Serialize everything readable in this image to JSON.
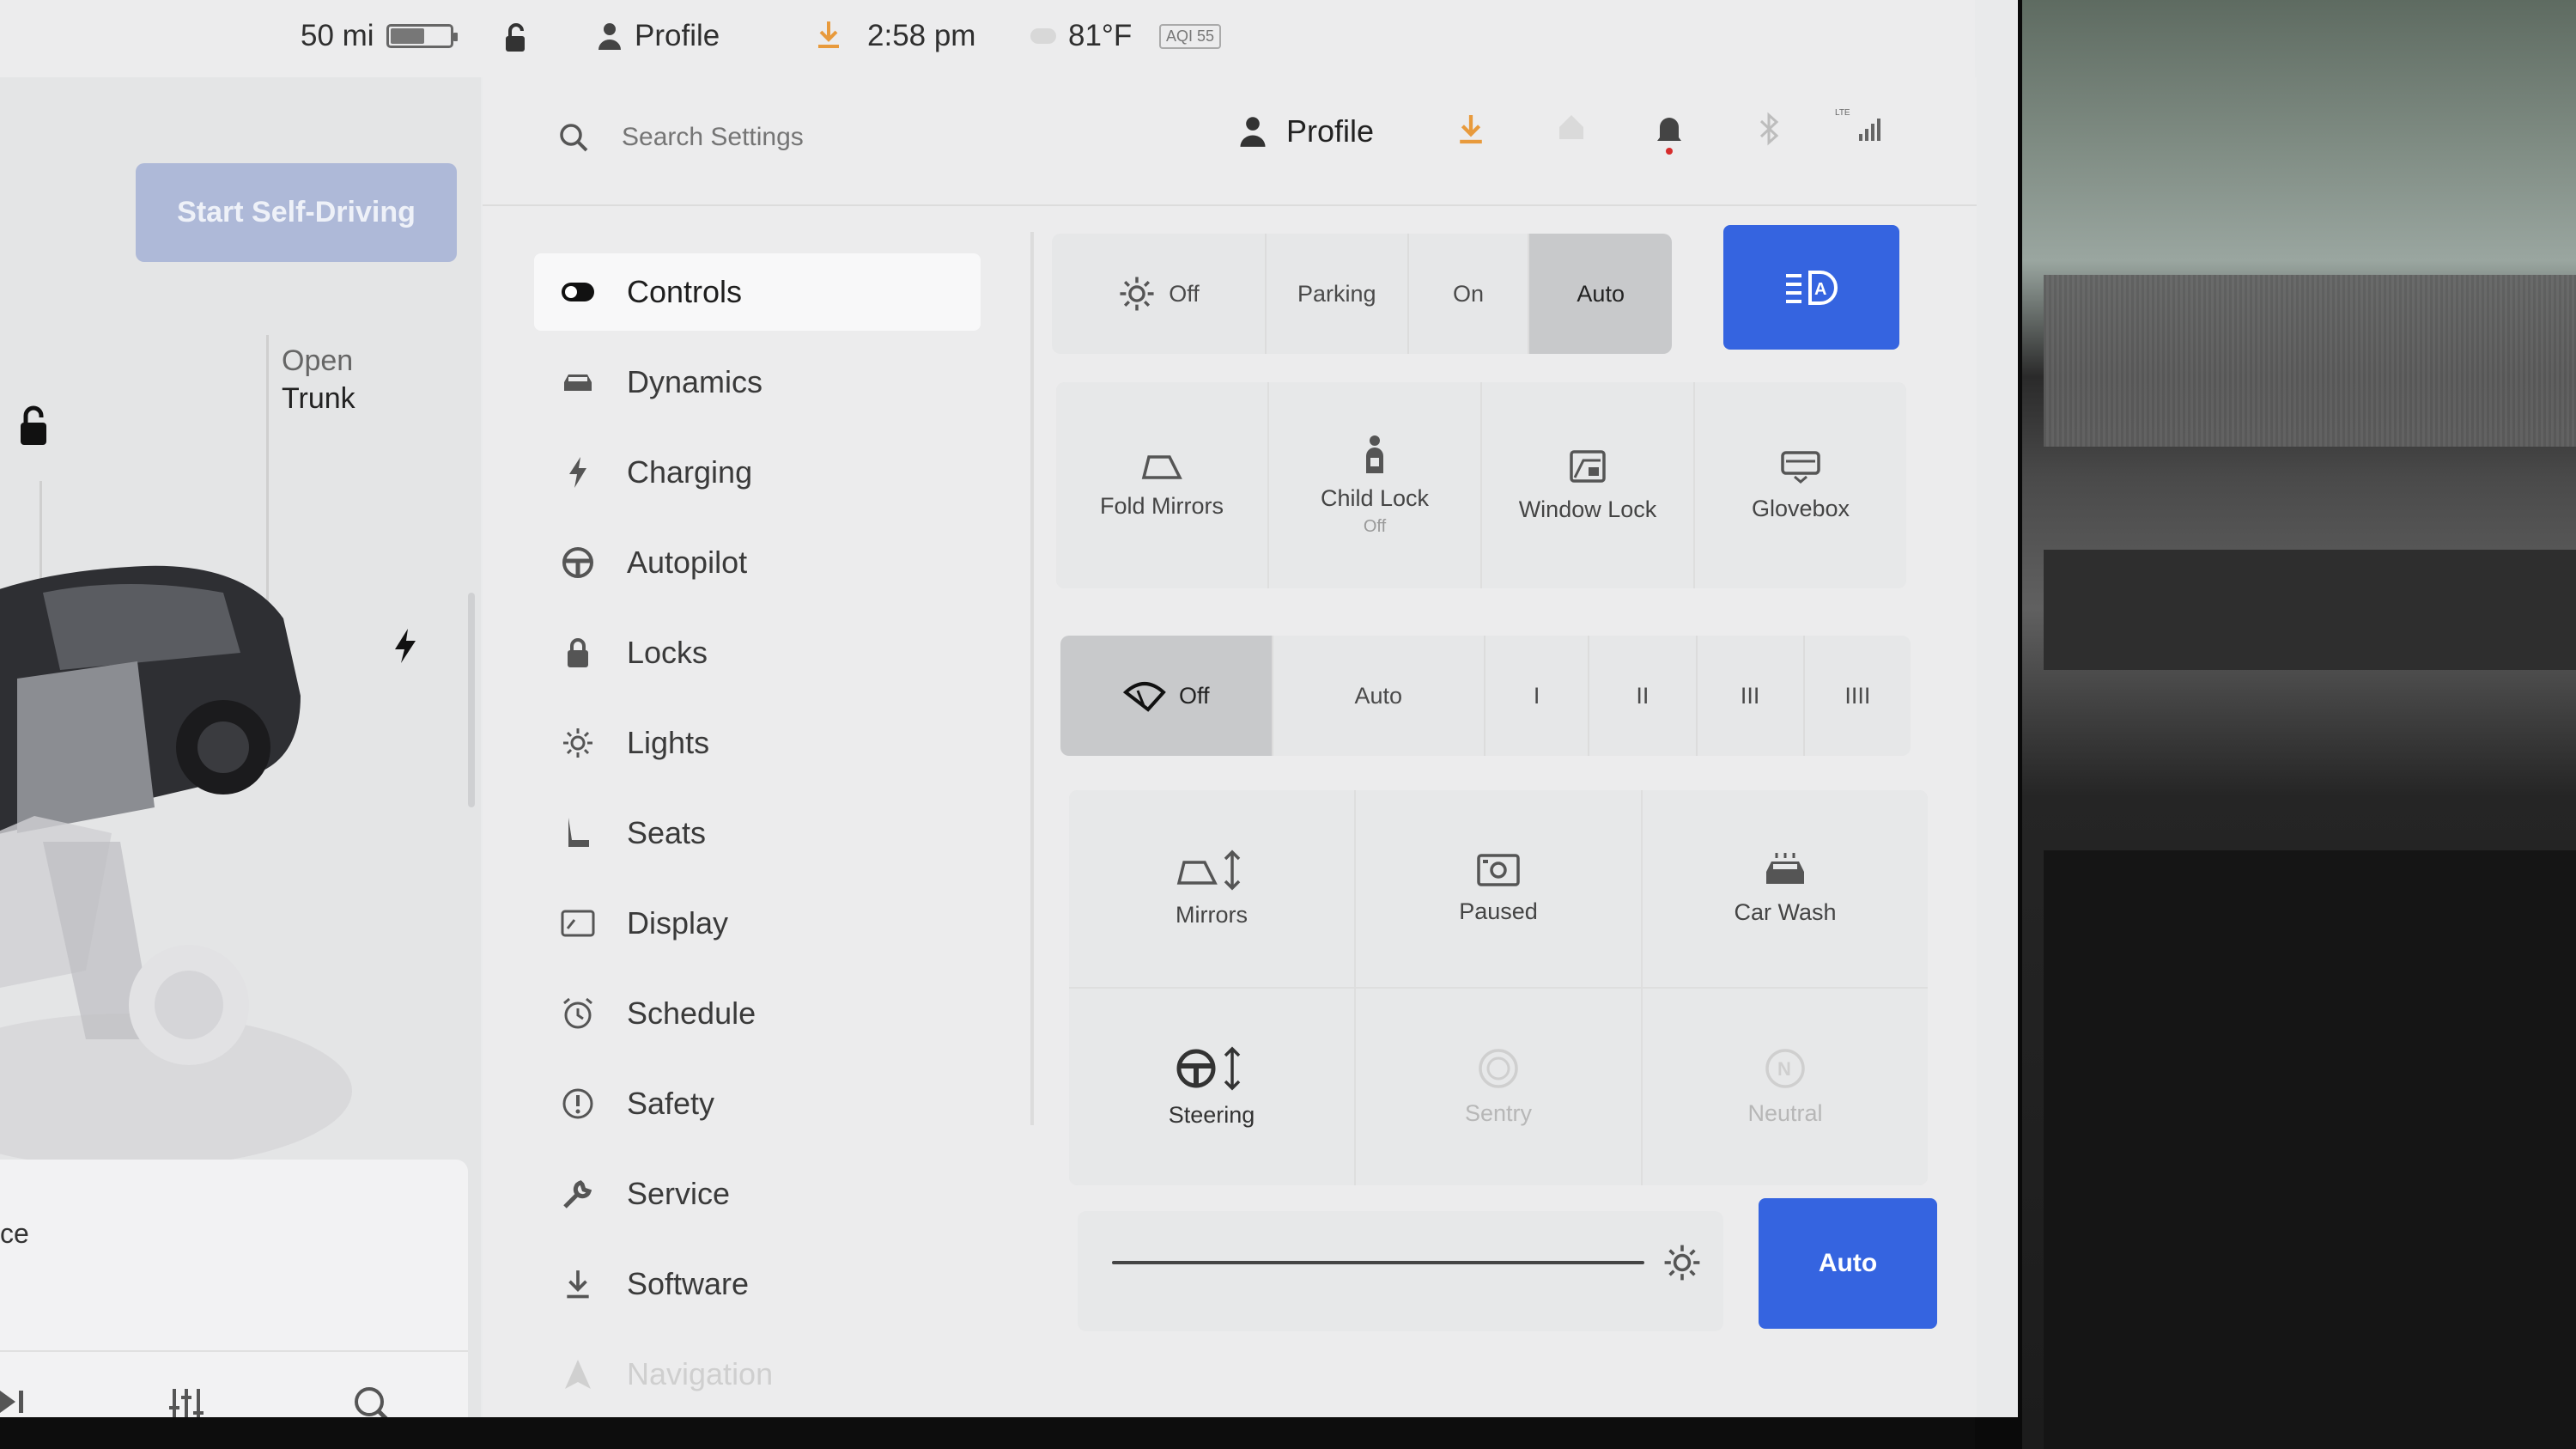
{
  "status_bar": {
    "range": "50 mi",
    "profile": "Profile",
    "time": "2:58 pm",
    "temperature": "81°F",
    "aqi": "AQI 55"
  },
  "car_panel": {
    "self_driving_button": "Start Self-Driving",
    "trunk_line1": "Open",
    "trunk_line2": "Trunk",
    "media_text": "ce"
  },
  "settings": {
    "search_placeholder": "Search Settings",
    "profile_label": "Profile",
    "nav": [
      {
        "label": "Controls",
        "icon": "toggle-icon"
      },
      {
        "label": "Dynamics",
        "icon": "car-icon"
      },
      {
        "label": "Charging",
        "icon": "bolt-icon"
      },
      {
        "label": "Autopilot",
        "icon": "steering-wheel-icon"
      },
      {
        "label": "Locks",
        "icon": "lock-icon"
      },
      {
        "label": "Lights",
        "icon": "sun-icon"
      },
      {
        "label": "Seats",
        "icon": "seat-icon"
      },
      {
        "label": "Display",
        "icon": "display-icon"
      },
      {
        "label": "Schedule",
        "icon": "alarm-clock-icon"
      },
      {
        "label": "Safety",
        "icon": "alert-circle-icon"
      },
      {
        "label": "Service",
        "icon": "wrench-icon"
      },
      {
        "label": "Software",
        "icon": "download-icon"
      },
      {
        "label": "Navigation",
        "icon": "navigation-icon"
      }
    ]
  },
  "controls": {
    "lights": {
      "off": "Off",
      "parking": "Parking",
      "on": "On",
      "auto": "Auto",
      "selected": "Auto"
    },
    "quick_tiles": [
      {
        "label": "Fold Mirrors",
        "sub": ""
      },
      {
        "label": "Child Lock",
        "sub": "Off"
      },
      {
        "label": "Window Lock",
        "sub": ""
      },
      {
        "label": "Glovebox",
        "sub": ""
      }
    ],
    "wipers": {
      "off": "Off",
      "auto": "Auto",
      "levels": [
        "I",
        "II",
        "III",
        "IIII"
      ],
      "selected": "Off"
    },
    "feature_tiles": [
      {
        "label": "Mirrors"
      },
      {
        "label": "Paused"
      },
      {
        "label": "Car Wash"
      },
      {
        "label": "Steering"
      },
      {
        "label": "Sentry"
      },
      {
        "label": "Neutral"
      }
    ],
    "brightness": {
      "auto_label": "Auto",
      "level_fraction": 1.0
    }
  },
  "colors": {
    "accent": "#3564e0",
    "charging_icon": "#e89a3c",
    "notification_dot": "#d62c2c"
  }
}
